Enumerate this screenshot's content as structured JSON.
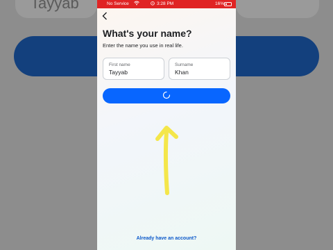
{
  "background": {
    "name_value": "Tayyab"
  },
  "status_bar": {
    "carrier": "No Service",
    "time": "3:28 PM",
    "battery": "16%"
  },
  "page": {
    "title": "What's your name?",
    "subtitle": "Enter the name you use in real life."
  },
  "form": {
    "first_name": {
      "label": "First name",
      "value": "Tayyab"
    },
    "surname": {
      "label": "Surname",
      "value": "Khan"
    }
  },
  "footer": {
    "login_link": "Already have an account?"
  },
  "colors": {
    "primary": "#0866ff",
    "status_bar": "#e02424",
    "annotation_arrow": "#f4e64a"
  },
  "icons": {
    "back": "chevron-left-icon",
    "loading": "spinner-icon",
    "wifi": "wifi-icon",
    "alarm": "alarm-icon"
  }
}
